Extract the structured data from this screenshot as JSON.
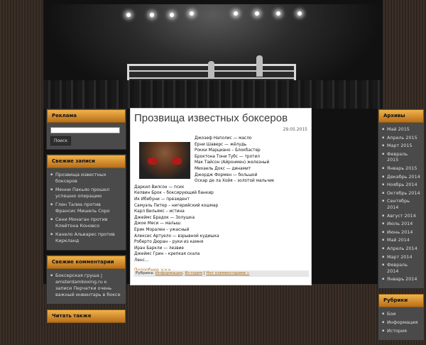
{
  "sidebar_left": {
    "ads": {
      "title": "Реклама"
    },
    "search": {
      "button": "Поиск",
      "placeholder": ""
    },
    "recent_posts": {
      "title": "Свежие записи",
      "items": [
        "Прозвища известных боксеров",
        "Менни Пакьяо прошел успешно операцию",
        "Глен Талиа против Франсис Мишель Соро",
        "Сени Монаган против Клейтона Коновсо",
        "Канело Альварес против Киркланд"
      ]
    },
    "recent_comments": {
      "title": "Свежие комментарии",
      "items": [
        "Боксерская груша | amsterdamboxing.ru к записи Перчатки очень важный инвентарь в боксе"
      ]
    },
    "read_also": {
      "title": "Читать также"
    }
  },
  "post": {
    "title": "Прозвища известных боксеров",
    "date": "29.05.2015",
    "lines": [
      "Джозеф Наполис — масло",
      "Ерни Шаверс — жёлудь",
      "Рокки Марциано – Блокбастер",
      "Броктона Тони Тубс — тротил",
      "Мак Тайсон (Айронмен) железный",
      "Михаель Докс — динамит",
      "Джордж Формен — большой",
      "Оскар де ла Хойя – золотой мальчик",
      "Даркил Вилсон — псих",
      "Келвин Брок – боксирующий банкир",
      "Ик Ибебуни — президент",
      "Самуэль Питер – нигерийский кошмар",
      "Карл Вильямс – истина",
      "Джеймс Брадок — Золушка",
      "Джое Меси — малыш",
      "Ерик Морален – ужасный",
      "Алексис Артуело — взрывной кудишка",
      "Роберто Дюран – руки из камня",
      "Иран Баркли — лезвие",
      "Джеймс Грин – крепкая скала",
      "Ленс…"
    ],
    "more": "Подробнее >>>",
    "category_prefix": "Рубрика:",
    "categories": [
      "Информация",
      "История"
    ],
    "comments": "Нет комментариев »"
  },
  "sidebar_right": {
    "archive": {
      "title": "Архивы",
      "items": [
        "Май 2015",
        "Апрель 2015",
        "Март 2015",
        "Февраль 2015",
        "Январь 2015",
        "Декабрь 2014",
        "Ноябрь 2014",
        "Октябрь 2014",
        "Сентябрь 2014",
        "Август 2014",
        "Июль 2014",
        "Июнь 2014",
        "Май 2014",
        "Апрель 2014",
        "Март 2014",
        "Февраль 2014",
        "Январь 2014"
      ]
    },
    "rubrics": {
      "title": "Рубрики",
      "items": [
        "Бои",
        "Информация",
        "История"
      ]
    }
  }
}
